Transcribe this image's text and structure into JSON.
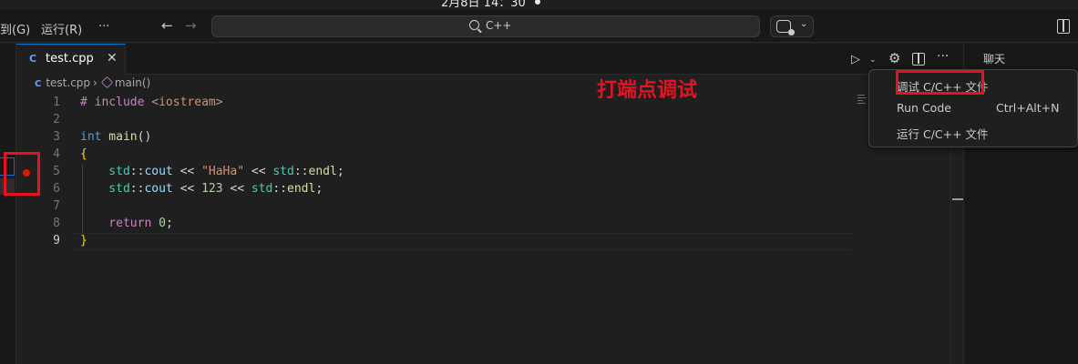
{
  "system": {
    "clock": "2月8日 14：30"
  },
  "titlebar": {
    "menu": [
      "到(G)",
      "运行(R)",
      "···"
    ],
    "search_text": "C++"
  },
  "tab": {
    "icon": "C",
    "label": "test.cpp",
    "close": "✕"
  },
  "toolbar": {
    "run_icon": "▷",
    "run_chevron": "⌄",
    "gear": "⚙",
    "more": "···"
  },
  "breadcrumb": {
    "icon": "C",
    "file": "test.cpp",
    "separator": "›",
    "symbol": "main()"
  },
  "line_numbers": [
    "1",
    "2",
    "3",
    "4",
    "5",
    "6",
    "7",
    "8",
    "9"
  ],
  "code": {
    "l1_kw": "# include",
    "l1_hdr": " <iostream>",
    "l3_type": "int",
    "l3_fn": " main",
    "l3_paren": "()",
    "l4": "{",
    "l5_ns": "    std",
    "l5_sep": "::",
    "l5_var": "cout",
    "l5_op": " << ",
    "l5_str": "\"HaHa\"",
    "l5_op2": " << ",
    "l5_ns2": "std",
    "l5_sep2": "::",
    "l5_fn": "endl",
    "l5_end": ";",
    "l6_ns": "    std",
    "l6_sep": "::",
    "l6_var": "cout",
    "l6_op": " << ",
    "l6_num": "123",
    "l6_op2": " << ",
    "l6_ns2": "std",
    "l6_sep2": "::",
    "l6_fn": "endl",
    "l6_end": ";",
    "l8_kw": "    return",
    "l8_num": " 0",
    "l8_end": ";",
    "l9": "}"
  },
  "annotation": "打端点调试",
  "chat_panel": {
    "title": "聊天"
  },
  "dropdown": {
    "items": [
      {
        "label": "调试 C/C++ 文件",
        "shortcut": ""
      },
      {
        "label": "Run Code",
        "shortcut": "Ctrl+Alt+N"
      },
      {
        "label": "运行 C/C++ 文件",
        "shortcut": ""
      }
    ]
  },
  "colors": {
    "accent": "#0078d4",
    "highlight_red": "#e81123",
    "breakpoint": "#e51400"
  }
}
